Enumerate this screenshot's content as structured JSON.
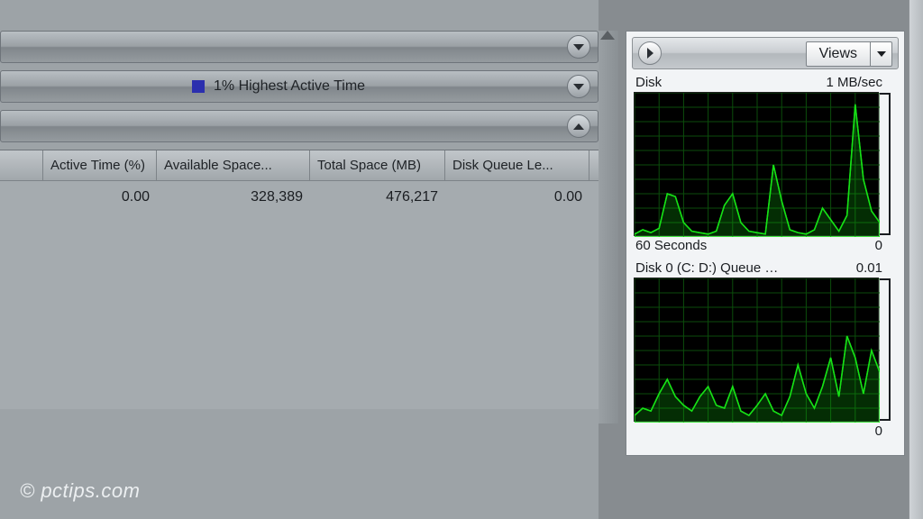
{
  "left": {
    "section2": {
      "legend_label": "1% Highest Active Time"
    },
    "table": {
      "headers": {
        "active": "Active Time (%)",
        "avail": "Available Space...",
        "total": "Total Space (MB)",
        "queue": "Disk Queue Le..."
      },
      "rows": [
        {
          "active": "0.00",
          "avail": "328,389",
          "total": "476,217",
          "queue": "0.00"
        }
      ]
    }
  },
  "right": {
    "views_label": "Views",
    "chart1": {
      "title_left": "Disk",
      "title_right": "1 MB/sec",
      "footer_left": "60 Seconds",
      "footer_right": "0"
    },
    "chart2": {
      "title_left": "Disk 0 (C: D:) Queue Len...",
      "title_right": "0.01",
      "footer_left": "",
      "footer_right": "0"
    }
  },
  "watermark": "© pctips.com",
  "chart_data": [
    {
      "type": "area",
      "title": "Disk",
      "xlabel": "60 Seconds",
      "ylabel": "MB/sec",
      "ylim": [
        0,
        1
      ],
      "x_seconds_ago": [
        60,
        58,
        56,
        54,
        52,
        50,
        48,
        46,
        44,
        42,
        40,
        38,
        36,
        34,
        32,
        30,
        28,
        26,
        24,
        22,
        20,
        18,
        16,
        14,
        12,
        10,
        8,
        6,
        4,
        2,
        0
      ],
      "values_mb_per_sec": [
        0.02,
        0.05,
        0.03,
        0.06,
        0.3,
        0.28,
        0.1,
        0.04,
        0.03,
        0.02,
        0.04,
        0.22,
        0.3,
        0.1,
        0.04,
        0.03,
        0.02,
        0.5,
        0.25,
        0.05,
        0.03,
        0.02,
        0.05,
        0.2,
        0.12,
        0.04,
        0.15,
        0.92,
        0.4,
        0.18,
        0.1
      ]
    },
    {
      "type": "area",
      "title": "Disk 0 (C: D:) Queue Length",
      "xlabel": "60 Seconds",
      "ylabel": "Queue Length",
      "ylim": [
        0,
        0.01
      ],
      "x_seconds_ago": [
        60,
        58,
        56,
        54,
        52,
        50,
        48,
        46,
        44,
        42,
        40,
        38,
        36,
        34,
        32,
        30,
        28,
        26,
        24,
        22,
        20,
        18,
        16,
        14,
        12,
        10,
        8,
        6,
        4,
        2,
        0
      ],
      "values_queue_len": [
        0.0005,
        0.001,
        0.0008,
        0.002,
        0.003,
        0.0018,
        0.0012,
        0.0008,
        0.0018,
        0.0025,
        0.0012,
        0.001,
        0.0025,
        0.0008,
        0.0005,
        0.0012,
        0.002,
        0.0008,
        0.0005,
        0.0018,
        0.004,
        0.002,
        0.001,
        0.0025,
        0.0045,
        0.0018,
        0.006,
        0.0045,
        0.002,
        0.005,
        0.0035
      ]
    }
  ]
}
